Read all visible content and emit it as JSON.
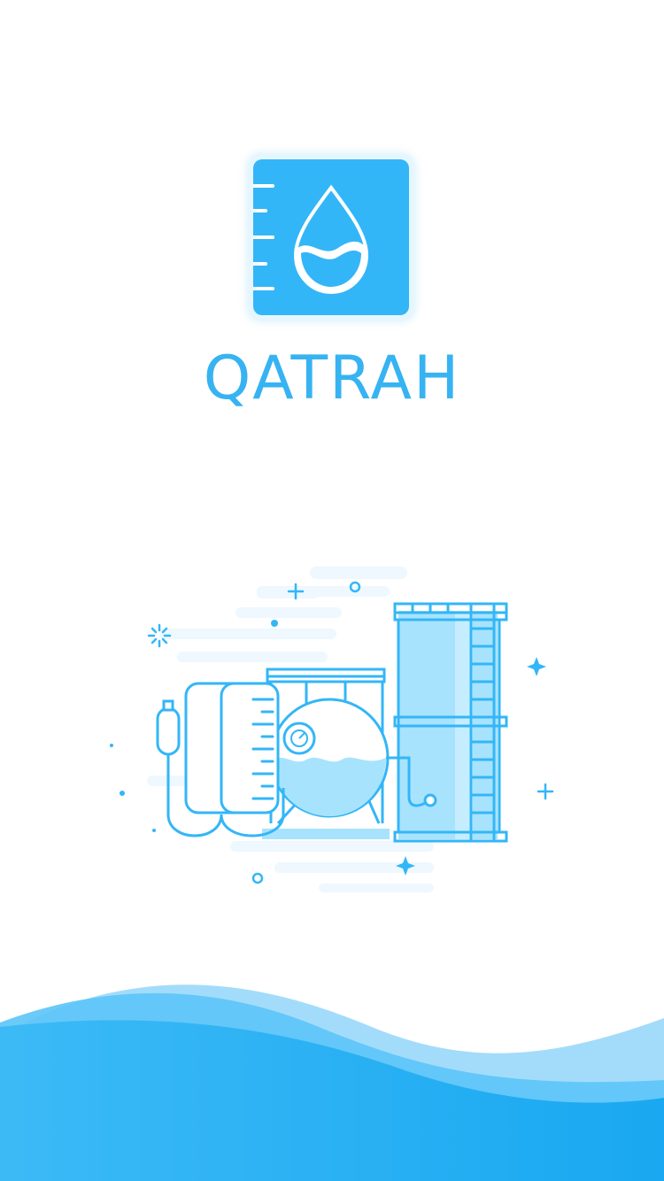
{
  "app": {
    "name": "QATRAH",
    "brand_color": "#33b6f7",
    "text_color": "#37b3f2"
  },
  "logo": {
    "icon": "water-drop-measure-icon"
  },
  "illustration": {
    "icon": "water-tank-illustration",
    "line_color": "#33b6f7",
    "fill_color": "#a8e3fd"
  },
  "footer": {
    "icon": "wave-decoration",
    "colors": [
      "#1aa9f1",
      "#5cc4f8",
      "#a3dcfb"
    ]
  }
}
